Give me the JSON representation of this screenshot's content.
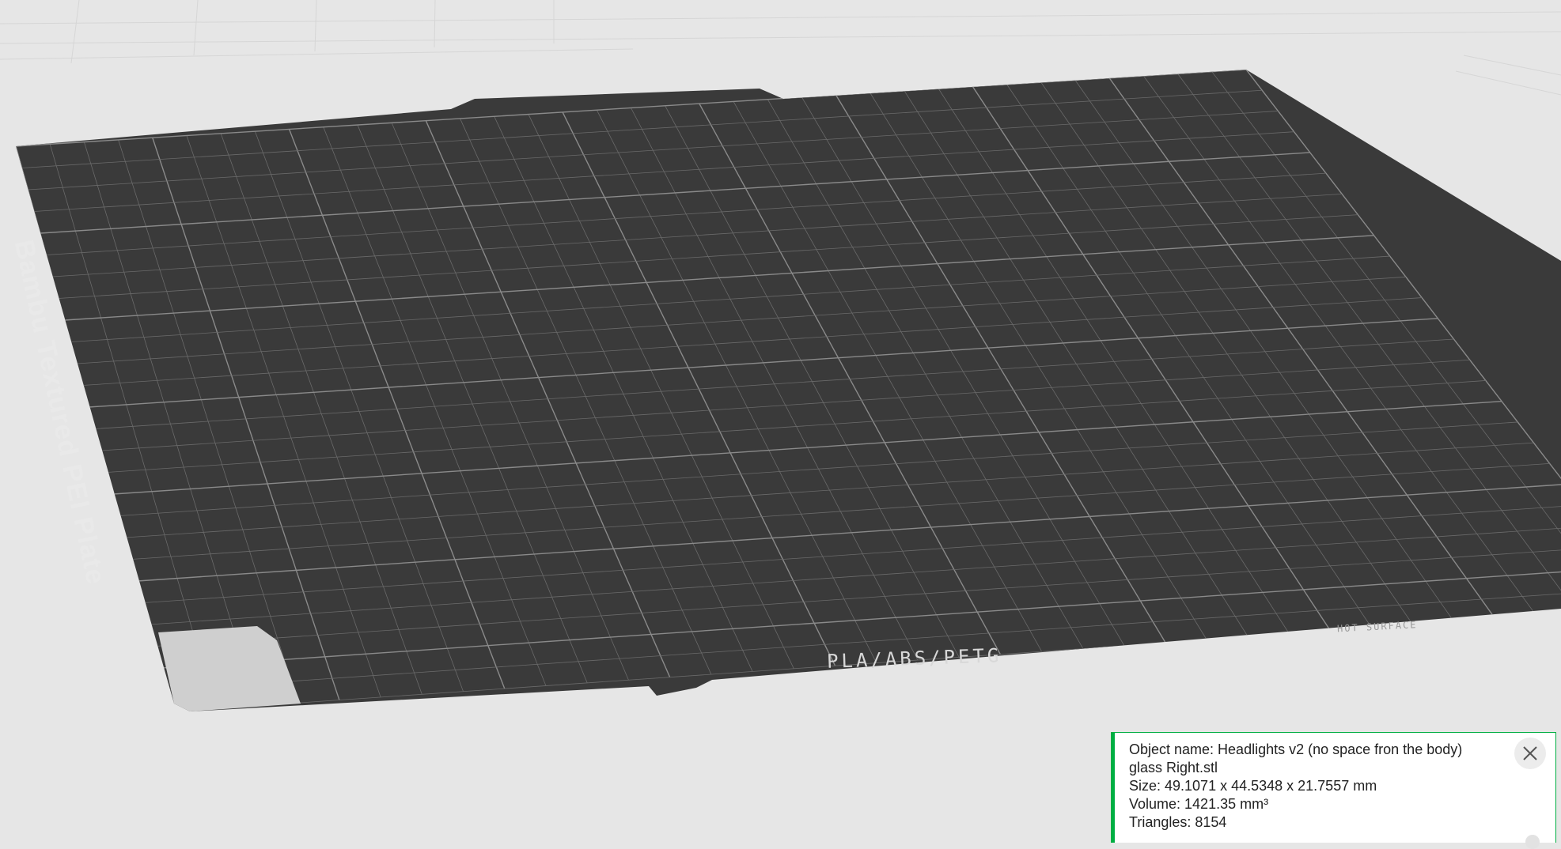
{
  "plate": {
    "name_label": "Bambu Textured PEI Plate",
    "filament_label": "PLA/ABS/PETG",
    "warning_label": "HOT SURFACE"
  },
  "object_info": {
    "name_line": "Object name: Headlights v2 (no space fron the body)",
    "name_line_2": "glass Right.stl",
    "size_line": "Size: 49.1071 x 44.5348 x 21.7557 mm",
    "volume_line": "Volume: 1421.35 mm³",
    "triangles_line": "Triangles: 8154"
  },
  "colors": {
    "accent": "#00ae42",
    "background": "#e6e6e6",
    "plate": "#3a3a3a",
    "model": "#2b2b2b",
    "selection_outline": "#ffffff"
  },
  "plate_toolbar": {
    "icons": [
      "delete-icon",
      "arrange-icon",
      "orient-icon",
      "lock-icon",
      "settings-icon"
    ]
  }
}
